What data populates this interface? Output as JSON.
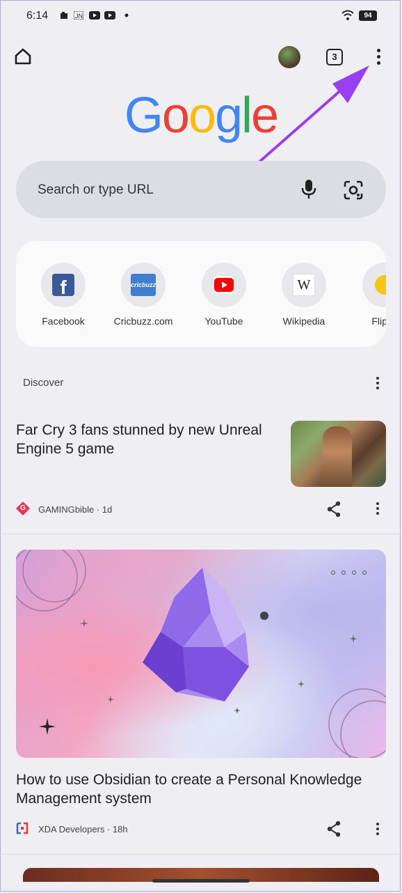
{
  "status_bar": {
    "time": "6:14",
    "battery": "94"
  },
  "toolbar": {
    "tab_count": "3"
  },
  "logo": {
    "letters": [
      "G",
      "o",
      "o",
      "g",
      "l",
      "e"
    ],
    "colors": [
      "#4285F4",
      "#EA4335",
      "#FBBC05",
      "#4285F4",
      "#34A853",
      "#EA4335"
    ]
  },
  "search": {
    "placeholder": "Search or type URL"
  },
  "shortcuts": [
    {
      "label": "Facebook",
      "icon": "facebook-icon"
    },
    {
      "label": "Cricbuzz.com",
      "icon": "cricbuzz-icon",
      "badge": "cricbuzz"
    },
    {
      "label": "YouTube",
      "icon": "youtube-icon"
    },
    {
      "label": "Wikipedia",
      "icon": "wikipedia-icon",
      "badge": "W"
    },
    {
      "label": "Flipka",
      "icon": "flipkart-icon"
    }
  ],
  "discover": {
    "heading": "Discover",
    "articles": [
      {
        "title": "Far Cry 3 fans stunned by new Unreal Engine 5 game",
        "source": "GAMINGbible · 1d",
        "source_badge": "G"
      },
      {
        "title": "How to use Obsidian to create a Personal Knowledge Management system",
        "source": "XDA Developers · 18h"
      }
    ]
  },
  "annotation": {
    "color": "#9b3df0"
  }
}
